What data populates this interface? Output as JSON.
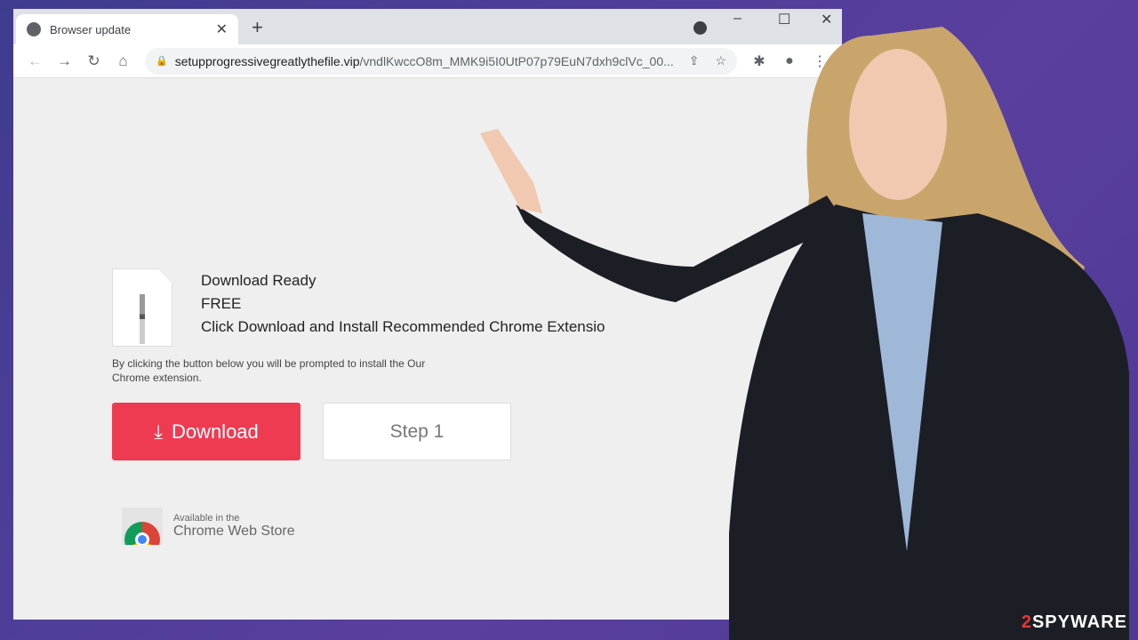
{
  "browser": {
    "tab_title": "Browser update",
    "url_host": "setupprogressivegreatlythefile.vip",
    "url_path": "/vndlKwccO8m_MMK9i5I0UtP07p79EuN7dxh9clVc_00..."
  },
  "page": {
    "line1": "Download Ready",
    "line2": "FREE",
    "line3": "Click Download and Install Recommended Chrome Extensio",
    "note": "By clicking the button below you will be prompted to install the Our Chrome extension.",
    "download_label": "Download",
    "step_label": "Step 1",
    "cws_small": "Available in the",
    "cws_main": "Chrome Web Store"
  },
  "watermark": {
    "text_accent": "2",
    "text": "SPYWAR",
    "text_end": "E"
  },
  "colors": {
    "download": "#ef3b52",
    "background": "#4d3a95"
  }
}
